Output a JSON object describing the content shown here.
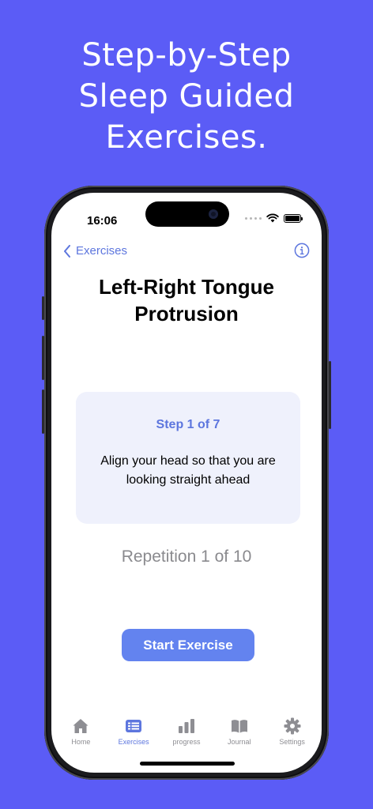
{
  "promo": {
    "headline_lines": [
      "Step-by-Step",
      "Sleep Guided",
      "Exercises."
    ]
  },
  "status_bar": {
    "time": "16:06"
  },
  "nav": {
    "back_label": "Exercises"
  },
  "exercise": {
    "title": "Left-Right Tongue Protrusion",
    "step_label": "Step 1 of 7",
    "instruction": "Align your head so that you are looking straight ahead",
    "repetition_label": "Repetition 1 of 10",
    "start_button": "Start Exercise"
  },
  "tabs": [
    {
      "label": "Home",
      "icon": "house-icon",
      "active": false
    },
    {
      "label": "Exercises",
      "icon": "list-icon",
      "active": true
    },
    {
      "label": "progress",
      "icon": "bar-chart-icon",
      "active": false
    },
    {
      "label": "Journal",
      "icon": "book-icon",
      "active": false
    },
    {
      "label": "Settings",
      "icon": "gear-icon",
      "active": false
    }
  ],
  "colors": {
    "background": "#5b5cf6",
    "accent": "#5d76de",
    "button": "#6383ef",
    "card": "#eff1fc"
  }
}
